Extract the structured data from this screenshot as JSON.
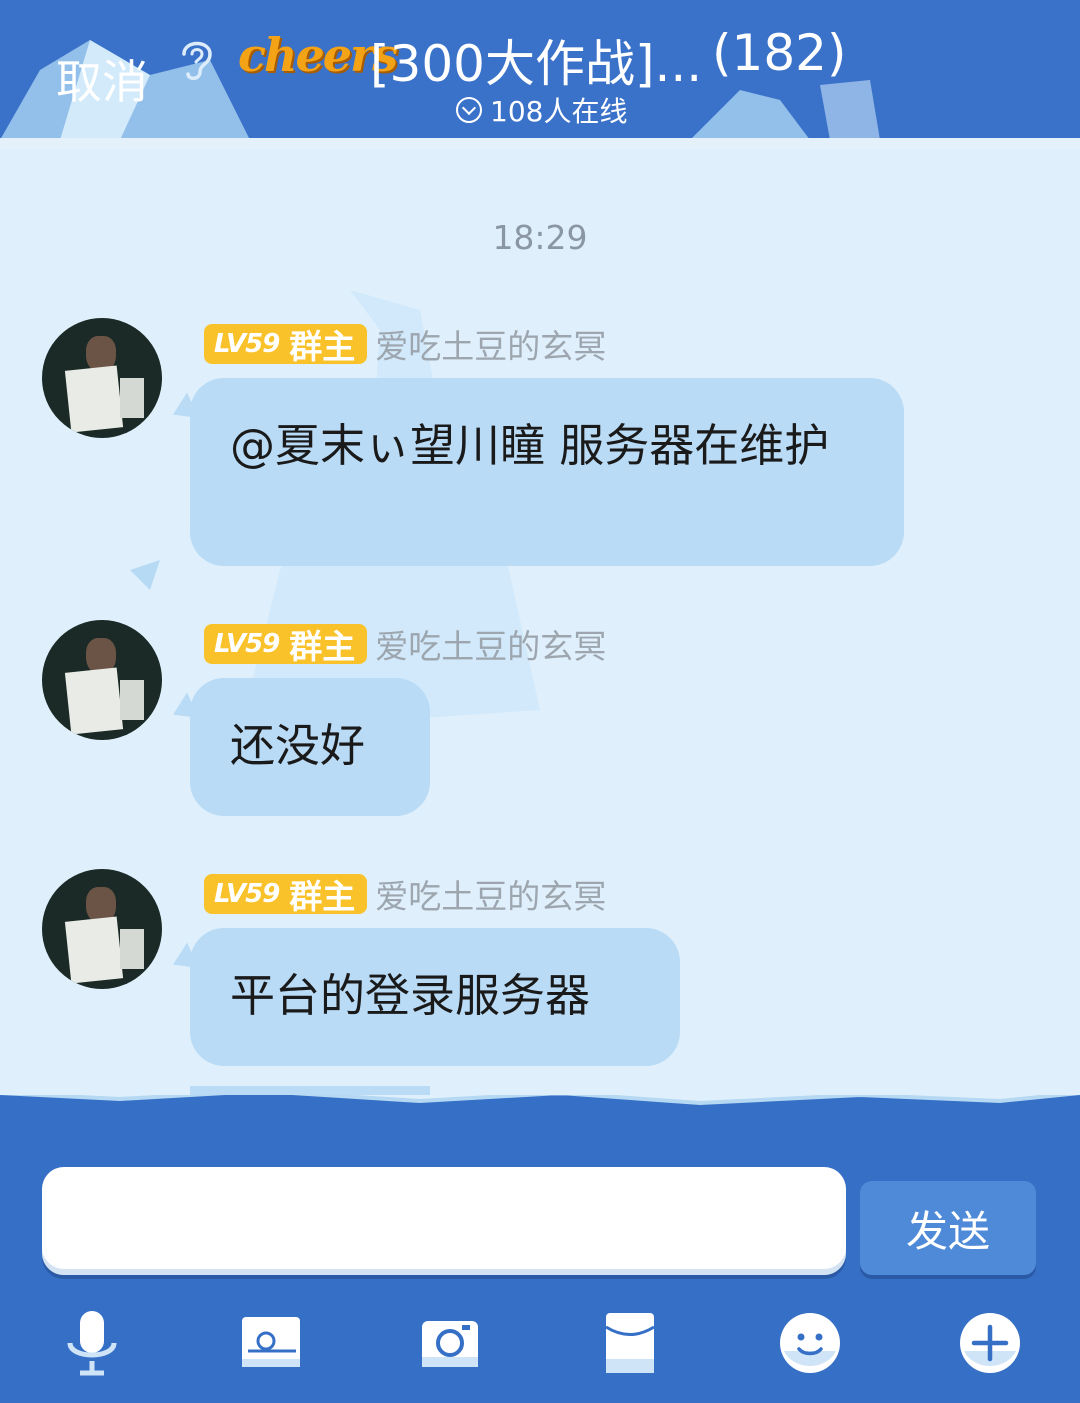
{
  "header": {
    "cancel_label": "取消",
    "logo_text": "cheers",
    "group_name": "[300大作战]...",
    "member_count": "(182)",
    "online_text": "108人在线"
  },
  "chat": {
    "timestamp": "18:29",
    "messages": [
      {
        "level": "LV59",
        "role": "群主",
        "sender": "爱吃土豆的玄冥",
        "text": "@夏末ぃ望川瞳 服务器在维护"
      },
      {
        "level": "LV59",
        "role": "群主",
        "sender": "爱吃土豆的玄冥",
        "text": "还没好"
      },
      {
        "level": "LV59",
        "role": "群主",
        "sender": "爱吃土豆的玄冥",
        "text": "平台的登录服务器"
      }
    ]
  },
  "input": {
    "placeholder": "",
    "send_label": "发送"
  },
  "toolbar": {
    "icons": [
      "microphone-icon",
      "picture-icon",
      "camera-icon",
      "red-packet-icon",
      "emoji-icon",
      "plus-icon"
    ]
  },
  "colors": {
    "header_blue": "#3b72c9",
    "bubble": "#b9dbf6",
    "badge": "#f9c22b",
    "send_button": "#4e8ad7"
  }
}
